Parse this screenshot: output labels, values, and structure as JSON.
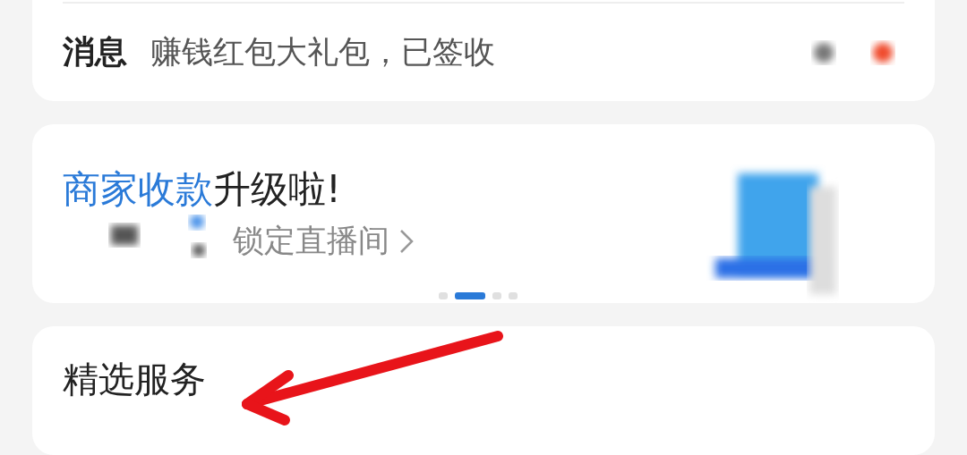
{
  "message": {
    "label": "消息",
    "text": "赚钱红包大礼包，已签收"
  },
  "banner": {
    "title_highlight": "商家收款",
    "title_rest": "升级啦!",
    "link": "锁定直播间",
    "pages": [
      {
        "selected": false
      },
      {
        "selected": true
      },
      {
        "selected": false
      },
      {
        "selected": false
      }
    ]
  },
  "section": {
    "title": "精选服务"
  }
}
